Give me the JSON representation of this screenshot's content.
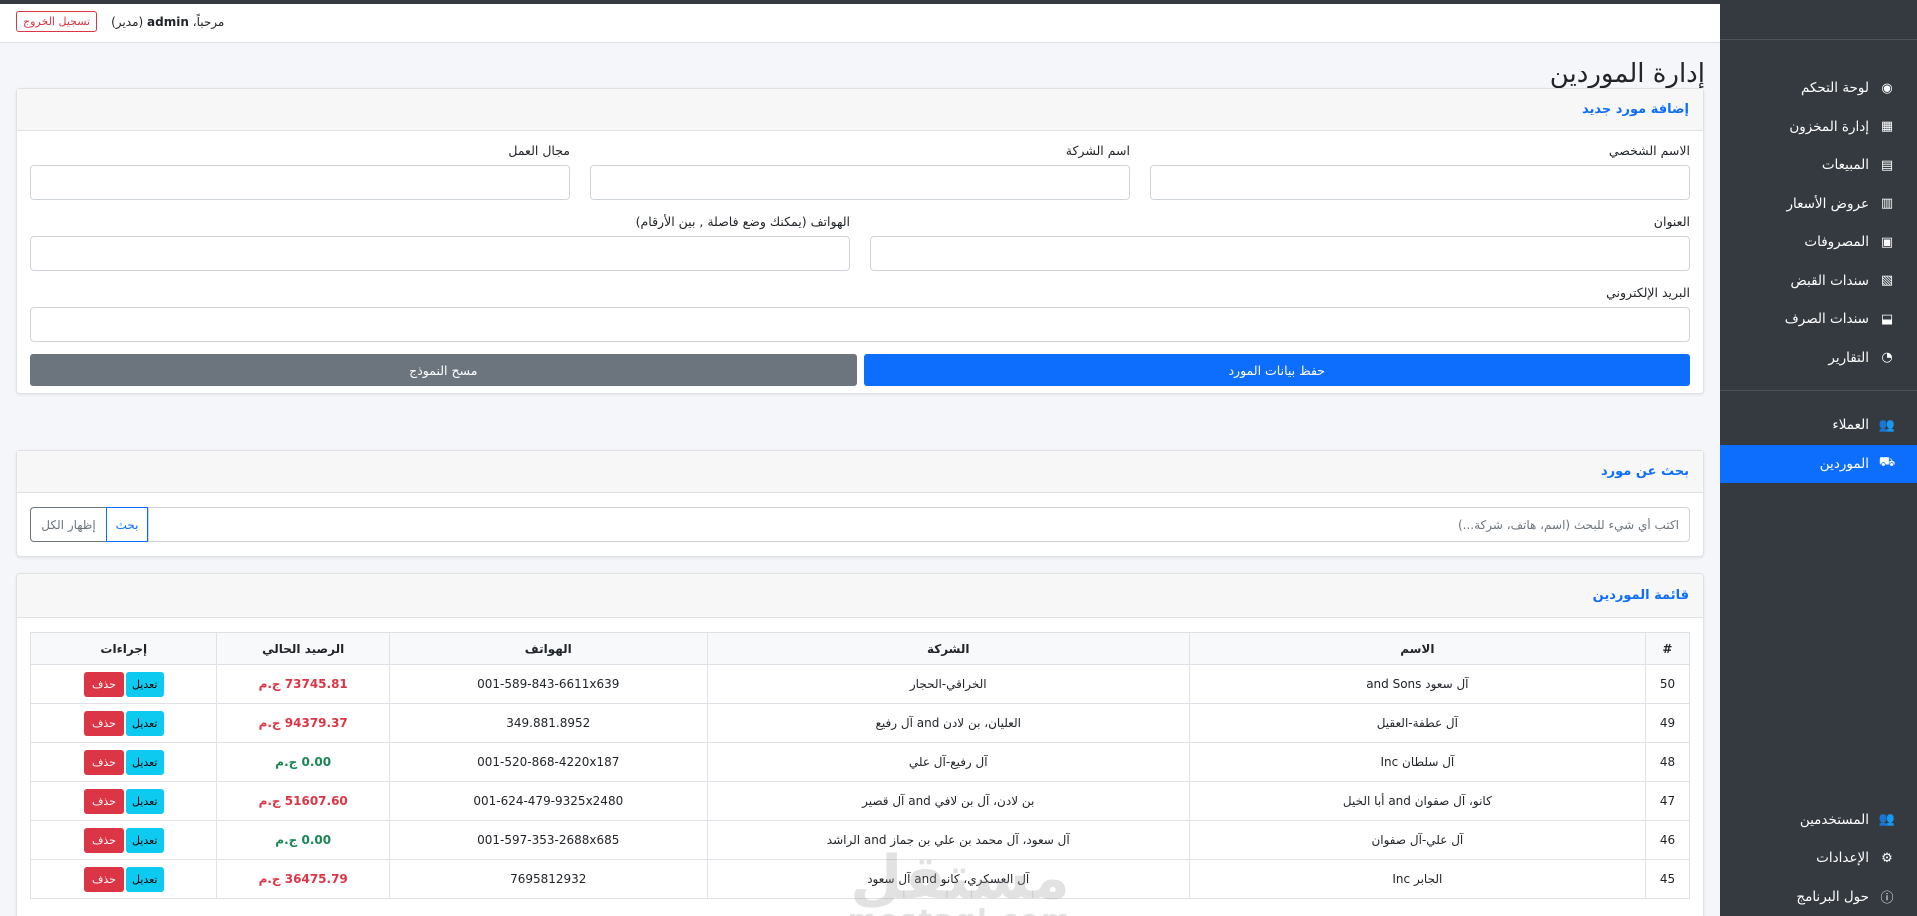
{
  "header": {
    "logout_label": "تسجيل الخروج",
    "welcome_prefix": "مرحباً،",
    "username": "admin",
    "role": "(مدير)"
  },
  "sidebar": {
    "items": [
      {
        "label": "لوحة التحكم",
        "icon": "dashboard-icon",
        "glyph": "◉"
      },
      {
        "label": "إدارة المخزون",
        "icon": "boxes-icon",
        "glyph": "▦"
      },
      {
        "label": "المبيعات",
        "icon": "cash-register-icon",
        "glyph": "▤"
      },
      {
        "label": "عروض الأسعار",
        "icon": "invoice-icon",
        "glyph": "▥"
      },
      {
        "label": "المصروفات",
        "icon": "money-bill-icon",
        "glyph": "▣"
      },
      {
        "label": "سندات القبض",
        "icon": "receipt-icon",
        "glyph": "▧"
      },
      {
        "label": "سندات الصرف",
        "icon": "hand-holding-usd-icon",
        "glyph": "⬓"
      },
      {
        "label": "التقارير",
        "icon": "chart-pie-icon",
        "glyph": "◔"
      }
    ],
    "items2": [
      {
        "label": "العملاء",
        "icon": "users-icon",
        "glyph": "👥"
      },
      {
        "label": "الموردين",
        "icon": "truck-icon",
        "glyph": "⛟"
      }
    ],
    "bottom_items": [
      {
        "label": "المستخدمين",
        "icon": "users-cog-icon",
        "glyph": "👥"
      },
      {
        "label": "الإعدادات",
        "icon": "cogs-icon",
        "glyph": "⚙"
      },
      {
        "label": "حول البرنامج",
        "icon": "info-circle-icon",
        "glyph": "ⓘ"
      }
    ]
  },
  "page": {
    "title": "إدارة الموردين"
  },
  "add_form": {
    "header": "إضافة مورد جديد",
    "personal_name_label": "الاسم الشخصي",
    "company_name_label": "اسم الشركة",
    "field_label": "مجال العمل",
    "address_label": "العنوان",
    "phones_label": "الهواتف (يمكنك وضع فاصلة , بين الأرقام)",
    "email_label": "البريد الإلكتروني",
    "save_label": "حفظ بيانات المورد",
    "clear_label": "مسح النموذج"
  },
  "search": {
    "header": "بحث عن مورد",
    "placeholder": "اكتب أي شيء للبحث (اسم، هاتف، شركة...)",
    "search_label": "بحث",
    "show_all_label": "إظهار الكل"
  },
  "list": {
    "header": "قائمة الموردين",
    "columns": [
      "#",
      "الاسم",
      "الشركة",
      "الهواتف",
      "الرصيد الحالي",
      "إجراءات"
    ],
    "edit_label": "تعديل",
    "delete_label": "حذف",
    "rows": [
      {
        "id": "50",
        "name": "آل سعود and Sons",
        "company": "الخراقي-الحجار",
        "phone": "001-589-843-6611x639",
        "balance": "73745.81 ج.م",
        "zero": false
      },
      {
        "id": "49",
        "name": "آل عطفة-العقيل",
        "company": "العليان، بن لادن and آل رفيع",
        "phone": "349.881.8952",
        "balance": "94379.37 ج.م",
        "zero": false
      },
      {
        "id": "48",
        "name": "آل سلطان Inc",
        "company": "آل رفيع-آل علي",
        "phone": "001-520-868-4220x187",
        "balance": "0.00 ج.م",
        "zero": true
      },
      {
        "id": "47",
        "name": "كانو، آل صفوان and أبا الخيل",
        "company": "بن لادن، آل بن لافي and آل قصير",
        "phone": "001-624-479-9325x2480",
        "balance": "51607.60 ج.م",
        "zero": false
      },
      {
        "id": "46",
        "name": "آل علي-آل صفوان",
        "company": "آل سعود، آل محمد بن علي بن جماز and الراشد",
        "phone": "001-597-353-2688x685",
        "balance": "0.00 ج.م",
        "zero": true
      },
      {
        "id": "45",
        "name": "الجابر Inc",
        "company": "آل العسكري، كانو and آل سعود",
        "phone": "7695812932",
        "balance": "36475.79 ج.م",
        "zero": false
      }
    ]
  },
  "watermark": {
    "main": "مستقل",
    "sub": "mostaql.com"
  }
}
